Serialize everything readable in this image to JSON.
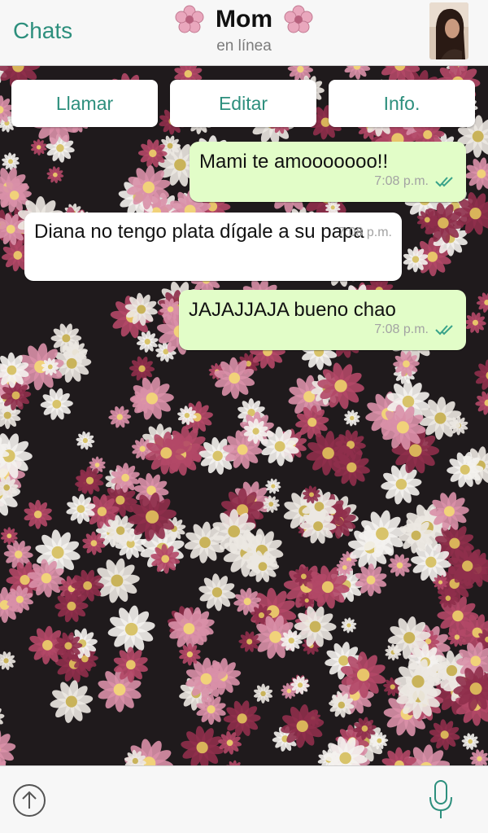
{
  "header": {
    "back_label": "Chats",
    "contact_name": "Mom",
    "status": "en línea",
    "title_icon": "flower-icon",
    "avatar_icon": "avatar"
  },
  "actions": [
    {
      "label": "Llamar"
    },
    {
      "label": "Editar"
    },
    {
      "label": "Info."
    }
  ],
  "messages": [
    {
      "direction": "outgoing",
      "text": "Mami te amooooooo!!",
      "time": "7:08 p.m.",
      "status": "read"
    },
    {
      "direction": "incoming",
      "text": "Diana no tengo plata dígale a su papa",
      "time": "7:08 p.m."
    },
    {
      "direction": "outgoing",
      "text": "JAJAJJAJA bueno chao",
      "time": "7:08 p.m.",
      "status": "read"
    }
  ],
  "composer": {
    "placeholder": "",
    "attach_icon": "upload-arrow-icon",
    "mic_icon": "microphone-icon"
  },
  "colors": {
    "accent": "#2d8f7d",
    "outgoing_bubble": "#e2fdc8",
    "incoming_bubble": "#ffffff",
    "read_ticks": "#3aa38a",
    "header_bg": "#f7f7f7"
  }
}
